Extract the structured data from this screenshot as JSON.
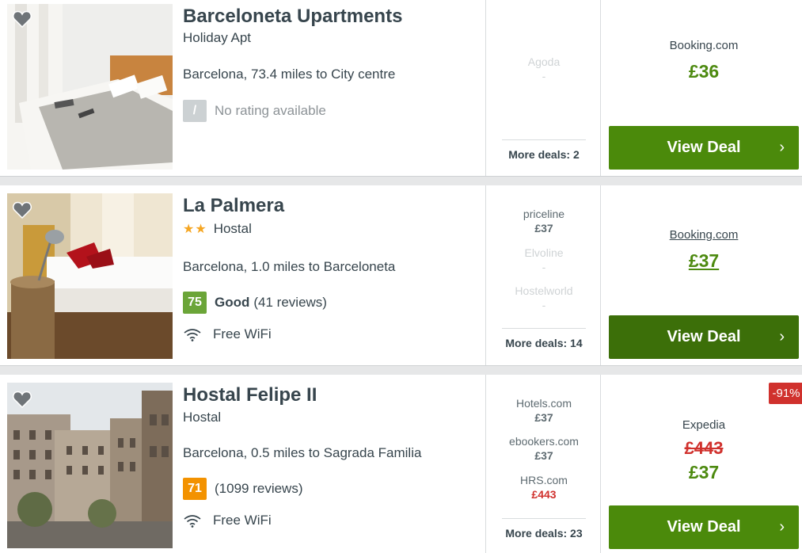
{
  "hotels": [
    {
      "name": "Barceloneta Upartments",
      "type": "Holiday Apt",
      "stars": "",
      "location": "Barcelona, 73.4 miles to City centre",
      "rating": {
        "score": "/",
        "label": "",
        "text": "No rating available"
      },
      "amenity": "",
      "deals": [
        {
          "provider": "Agoda",
          "price": "-"
        }
      ],
      "more_deals": "More deals: 2",
      "best": {
        "provider": "Booking.com",
        "old_price": "",
        "price": "£36",
        "discount": ""
      },
      "button": {
        "label": "View Deal",
        "chevron": "›"
      }
    },
    {
      "name": "La Palmera",
      "type": "Hostal",
      "stars": "★★",
      "location": "Barcelona, 1.0 miles to Barceloneta",
      "rating": {
        "score": "75",
        "label": "Good",
        "text": "(41 reviews)"
      },
      "amenity": "Free WiFi",
      "deals": [
        {
          "provider": "priceline",
          "price": "£37"
        },
        {
          "provider": "Elvoline",
          "price": "-"
        },
        {
          "provider": "Hostelworld",
          "price": "-"
        }
      ],
      "more_deals": "More deals: 14",
      "best": {
        "provider": "Booking.com",
        "old_price": "",
        "price": "£37",
        "discount": ""
      },
      "button": {
        "label": "View Deal",
        "chevron": "›"
      }
    },
    {
      "name": "Hostal Felipe II",
      "type": "Hostal",
      "stars": "",
      "location": "Barcelona, 0.5 miles to Sagrada Familia",
      "rating": {
        "score": "71",
        "label": "",
        "text": "(1099 reviews)"
      },
      "amenity": "Free WiFi",
      "deals": [
        {
          "provider": "Hotels.com",
          "price": "£37"
        },
        {
          "provider": "ebookers.com",
          "price": "£37"
        },
        {
          "provider": "HRS.com",
          "price": "£443"
        }
      ],
      "more_deals": "More deals: 23",
      "best": {
        "provider": "Expedia",
        "old_price": "£443",
        "price": "£37",
        "discount": "-91%"
      },
      "button": {
        "label": "View Deal",
        "chevron": "›"
      }
    }
  ],
  "icons": {
    "favorite": "heart-icon",
    "wifi": "wifi-icon",
    "next": "chevron-right-icon"
  },
  "colors": {
    "accent_green": "#4b8a0b",
    "price_green": "#4d8a10",
    "alert_red": "#d0312d",
    "score_good": "#6ba538",
    "score_okay": "#f39200"
  }
}
